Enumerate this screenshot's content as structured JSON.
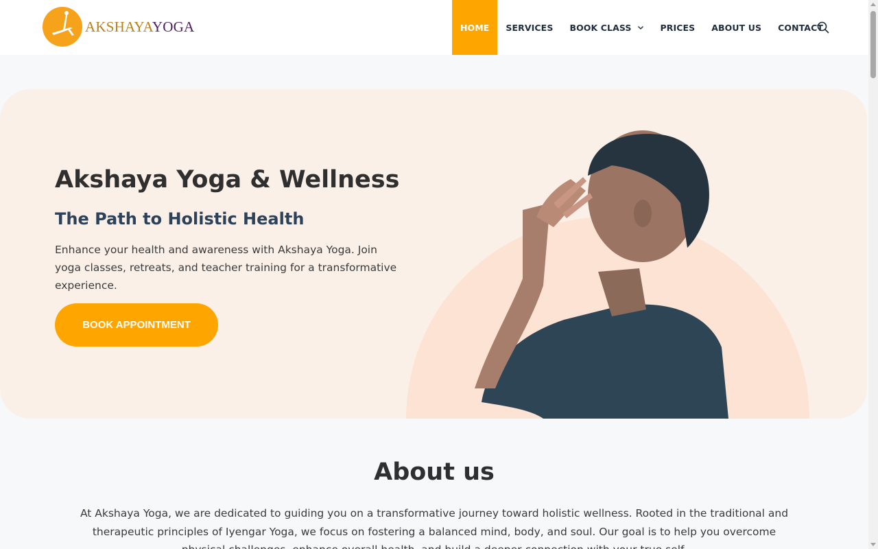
{
  "brand": {
    "name_part1": "AKSHAYA",
    "name_part2": "YOGA"
  },
  "nav": {
    "items": [
      {
        "label": "HOME",
        "active": true
      },
      {
        "label": "SERVICES"
      },
      {
        "label": "BOOK CLASS",
        "has_dropdown": true
      },
      {
        "label": "PRICES"
      },
      {
        "label": "ABOUT US"
      },
      {
        "label": "CONTACT"
      }
    ],
    "search_icon": "search-icon"
  },
  "hero": {
    "title": "Akshaya Yoga & Wellness",
    "subtitle": "The Path to Holistic Health",
    "description": "Enhance your health and awareness with Akshaya Yoga. Join yoga classes, retreats, and teacher training for a transformative experience.",
    "cta_label": "BOOK APPOINTMENT"
  },
  "about": {
    "title": "About us",
    "text": "At Akshaya Yoga, we are dedicated to guiding you on a transformative journey toward holistic wellness. Rooted in the traditional and therapeutic principles of Iyengar Yoga, we focus on fostering a balanced mind, body, and soul. Our goal is to help you overcome physical challenges, enhance overall health, and build a deeper connection with your true self."
  },
  "colors": {
    "accent": "#ffa500",
    "hero_bg": "#faf0e8",
    "nav_text": "#1f2d3d",
    "page_bg": "#f7f8fa"
  }
}
